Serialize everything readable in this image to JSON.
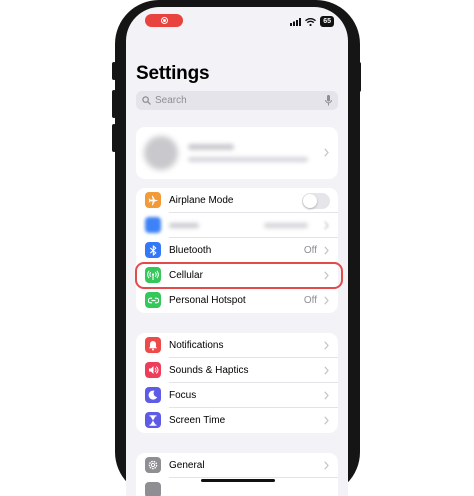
{
  "title": "Settings",
  "search": {
    "placeholder": "Search"
  },
  "status_bar": {
    "battery": "65"
  },
  "colors": {
    "airplane": "#f19a37",
    "wifi": "#3e82f7",
    "bluetooth": "#3478f6",
    "cellular": "#34c759",
    "hotspot": "#34c759",
    "notifications": "#ef4a4a",
    "sounds": "#ef3c5a",
    "focus": "#5e5ce6",
    "screen_time": "#5e5ce6",
    "general": "#8e8e93",
    "highlight": "#e34b4b"
  },
  "groups": {
    "connectivity": [
      {
        "label": "Airplane Mode",
        "icon": "airplane-icon",
        "toggle": false
      },
      {
        "label": "",
        "icon": "wifi-icon",
        "value": ""
      },
      {
        "label": "Bluetooth",
        "icon": "bluetooth-icon",
        "value": "Off"
      },
      {
        "label": "Cellular",
        "icon": "cellular-icon",
        "value": ""
      },
      {
        "label": "Personal Hotspot",
        "icon": "hotspot-icon",
        "value": "Off"
      }
    ],
    "notifications": [
      {
        "label": "Notifications",
        "icon": "bell-icon"
      },
      {
        "label": "Sounds & Haptics",
        "icon": "speaker-icon"
      },
      {
        "label": "Focus",
        "icon": "moon-icon"
      },
      {
        "label": "Screen Time",
        "icon": "hourglass-icon"
      }
    ],
    "general": [
      {
        "label": "General",
        "icon": "gear-icon"
      }
    ]
  }
}
